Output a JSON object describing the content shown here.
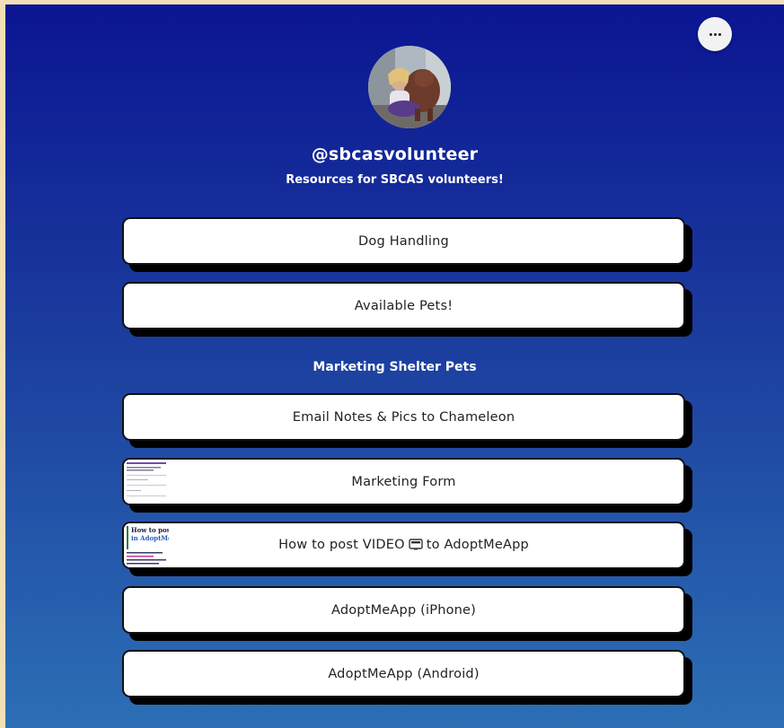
{
  "profile": {
    "handle": "@sbcasvolunteer",
    "bio": "Resources for SBCAS volunteers!"
  },
  "menu": {
    "icon": "more-dots-icon"
  },
  "links": {
    "dog_handling": "Dog Handling",
    "available_pets": "Available Pets!",
    "email_notes": "Email Notes & Pics to Chameleon",
    "marketing_form": "Marketing Form",
    "video_prefix": "How to post VIDEO",
    "video_suffix": "to AdoptMeApp",
    "iphone": "AdoptMeApp (iPhone)",
    "android": "AdoptMeApp (Android)"
  },
  "section": {
    "marketing": "Marketing Shelter Pets"
  },
  "thumb_video": {
    "line1": "How to post v",
    "line2": "in AdoptMe"
  },
  "colors": {
    "gradient_top": "#0b1592",
    "gradient_bottom": "#2c6fb5",
    "card_bg": "#ffffff",
    "card_shadow": "#000000",
    "outer_border": "#f3dfb6"
  }
}
